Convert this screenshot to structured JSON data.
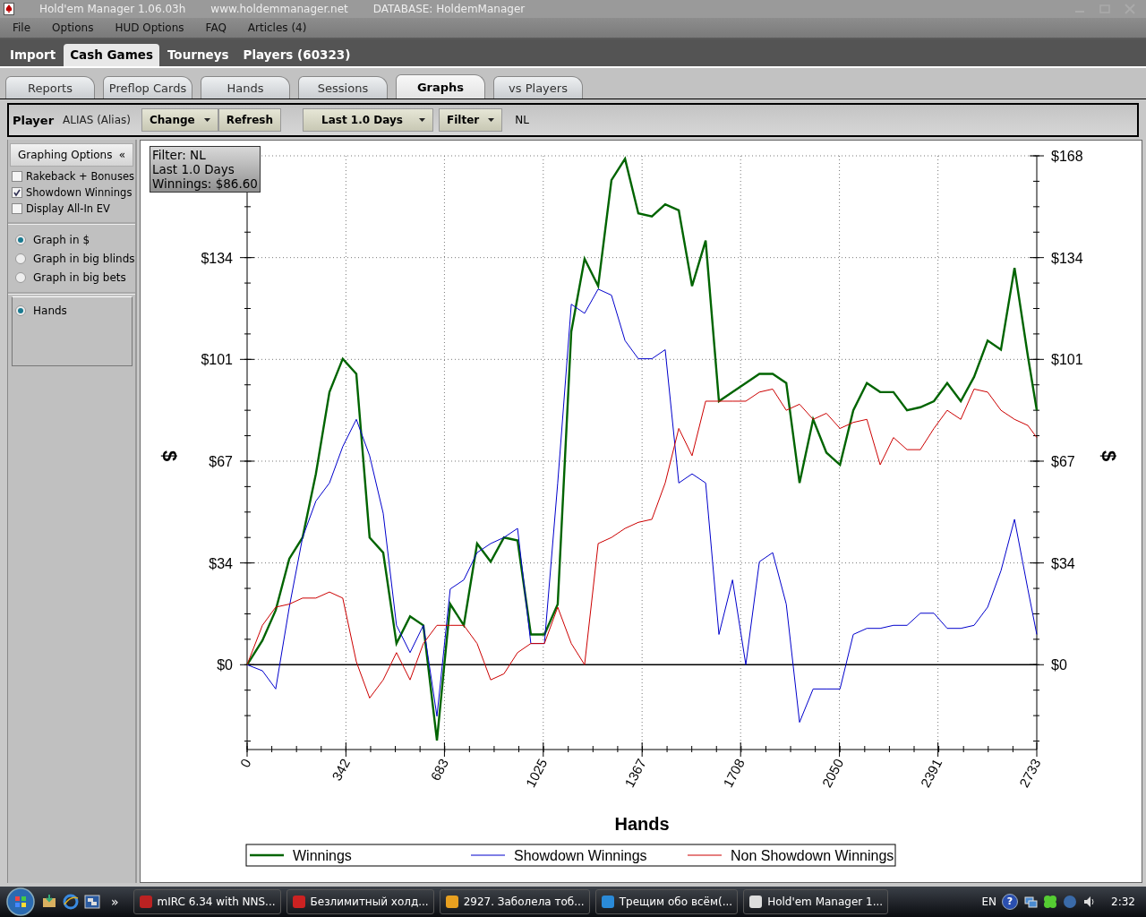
{
  "window": {
    "title": "Hold'em Manager 1.06.03h",
    "website": "www.holdemmanager.net",
    "database": "DATABASE: HoldemManager"
  },
  "menu": [
    "File",
    "Options",
    "HUD Options",
    "FAQ",
    "Articles (4)"
  ],
  "main_tabs": [
    {
      "label": "Import",
      "selected": false
    },
    {
      "label": "Cash Games",
      "selected": true
    },
    {
      "label": "Tourneys",
      "selected": false
    },
    {
      "label": "Players (60323)",
      "selected": false
    }
  ],
  "sub_tabs": [
    {
      "label": "Reports",
      "selected": false
    },
    {
      "label": "Preflop Cards",
      "selected": false
    },
    {
      "label": "Hands",
      "selected": false
    },
    {
      "label": "Sessions",
      "selected": false
    },
    {
      "label": "Graphs",
      "selected": true
    },
    {
      "label": "vs Players",
      "selected": false
    }
  ],
  "toolbar": {
    "player_label": "Player",
    "player_value": "ALIAS (Alias)",
    "player_buttons": [
      {
        "label": "Change",
        "dropdown": true
      },
      {
        "label": "Refresh",
        "dropdown": false
      }
    ],
    "period": {
      "label": "Last 1.0 Days",
      "dropdown": true
    },
    "filter": {
      "label": "Filter",
      "dropdown": true
    },
    "filter_value": "NL"
  },
  "sidebar": {
    "header": "Graphing Options",
    "collapse_glyph": "«",
    "checkboxes": [
      {
        "label": "Rakeback + Bonuses",
        "checked": false
      },
      {
        "label": "Showdown Winnings",
        "checked": true
      },
      {
        "label": "Display All-In EV",
        "checked": false
      }
    ],
    "units": [
      {
        "label": "Graph in $",
        "selected": true
      },
      {
        "label": "Graph in big blinds",
        "selected": false
      },
      {
        "label": "Graph in big bets",
        "selected": false
      }
    ],
    "x_axis": [
      {
        "label": "Hands",
        "selected": true
      }
    ]
  },
  "graph": {
    "info": [
      "Filter: NL",
      "Last 1.0 Days",
      "Winnings: $86.60"
    ],
    "ylabel_right": "$",
    "chart_data": {
      "type": "line",
      "xlabel": "Hands",
      "ylabel": "$",
      "x": [
        0,
        53,
        99,
        146,
        192,
        238,
        285,
        331,
        378,
        424,
        471,
        517,
        564,
        610,
        657,
        703,
        750,
        796,
        843,
        889,
        936,
        982,
        1029,
        1075,
        1122,
        1168,
        1215,
        1261,
        1308,
        1354,
        1401,
        1447,
        1494,
        1540,
        1587,
        1633,
        1680,
        1726,
        1773,
        1819,
        1866,
        1912,
        1959,
        2005,
        2052,
        2098,
        2145,
        2191,
        2237,
        2284,
        2330,
        2377,
        2423,
        2470,
        2516,
        2563,
        2609,
        2656,
        2702,
        2733
      ],
      "series": [
        {
          "name": "Winnings",
          "color": "#006400",
          "values": [
            0,
            8,
            18,
            35,
            42,
            63,
            90,
            101,
            96,
            42,
            37,
            7,
            16,
            13,
            -25,
            20,
            13,
            40,
            34,
            42,
            41,
            10,
            10,
            20,
            110,
            134,
            125,
            160,
            167,
            149,
            148,
            152,
            150,
            125,
            140,
            87,
            90,
            93,
            96,
            96,
            93,
            60,
            81,
            70,
            66,
            84,
            93,
            90,
            90,
            84,
            85,
            87,
            93,
            87,
            95,
            107,
            104,
            131,
            102,
            84
          ]
        },
        {
          "name": "Showdown Winnings",
          "color": "#0000cc",
          "values": [
            0,
            -2,
            -8,
            19,
            42,
            54,
            60,
            72,
            81,
            69,
            50,
            13,
            4,
            13,
            -17,
            25,
            28,
            37,
            40,
            42,
            45,
            7,
            7,
            60,
            119,
            116,
            124,
            122,
            107,
            101,
            101,
            104,
            60,
            63,
            60,
            10,
            28,
            0,
            34,
            37,
            20,
            -19,
            -8,
            -8,
            -8,
            10,
            12,
            12,
            13,
            13,
            17,
            17,
            12,
            12,
            13,
            19,
            31,
            48,
            25,
            10
          ]
        },
        {
          "name": "Non Showdown Winnings",
          "color": "#cc0000",
          "values": [
            0,
            13,
            19,
            20,
            22,
            22,
            24,
            22,
            1,
            -11,
            -5,
            4,
            -5,
            7,
            13,
            13,
            13,
            7,
            -5,
            -3,
            4,
            7,
            7,
            19,
            7,
            0,
            40,
            42,
            45,
            47,
            48,
            60,
            78,
            69,
            87,
            87,
            87,
            87,
            90,
            91,
            84,
            86,
            81,
            83,
            78,
            80,
            81,
            66,
            75,
            71,
            71,
            78,
            84,
            81,
            91,
            90,
            84,
            81,
            79,
            75
          ]
        }
      ],
      "grid": true,
      "legend": true,
      "xlim": [
        0,
        2733
      ],
      "ylim": [
        -28,
        168
      ],
      "xticks": [
        0,
        342,
        683,
        1025,
        1367,
        1708,
        2050,
        2391,
        2733
      ],
      "yticks": [
        {
          "value": 0,
          "label": "$0"
        },
        {
          "value": 33.6,
          "label": "$34"
        },
        {
          "value": 67.2,
          "label": "$67"
        },
        {
          "value": 100.8,
          "label": "$101"
        },
        {
          "value": 134.4,
          "label": "$134"
        },
        {
          "value": 168,
          "label": "$168"
        }
      ]
    }
  },
  "taskbar": {
    "tasks": [
      "mIRC 6.34 with NNS...",
      "Безлимитный холд...",
      "2927. Заболела тоб...",
      "Трещим обо всём(...",
      "Hold'em Manager 1..."
    ],
    "overflow_glyph": "»",
    "language": "EN",
    "help_glyph": "?",
    "time": "2:32"
  }
}
